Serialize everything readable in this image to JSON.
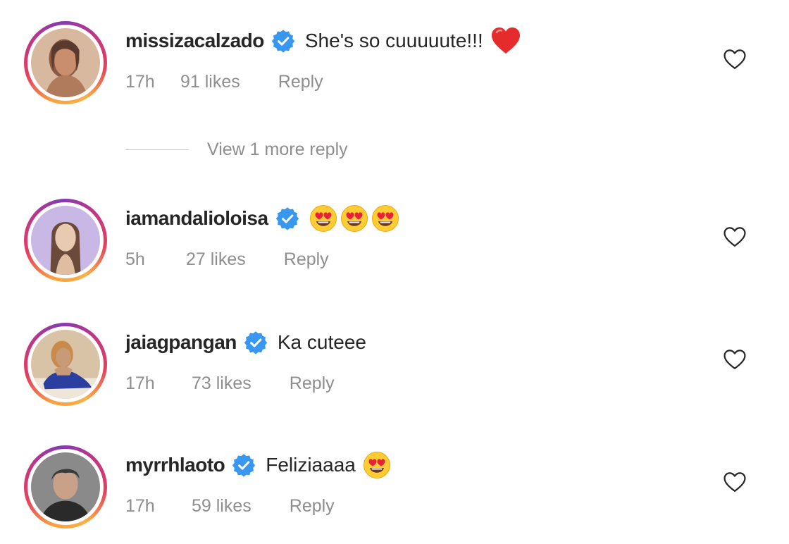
{
  "comments": [
    {
      "username": "missizacalzado",
      "text": "She's so cuuuuute!!!",
      "emoji": "red-heart",
      "time": "17h",
      "likes": "91 likes",
      "reply": "Reply",
      "avatar_colors": [
        "#8a5a44",
        "#5a3a2e",
        "#c88e6e"
      ]
    },
    {
      "username": "iamandalioloisa",
      "text": "",
      "emoji": "heart-eyes x3",
      "time": "5h",
      "likes": "27 likes",
      "reply": "Reply",
      "avatar_colors": [
        "#c9b7e6",
        "#6b4a3a",
        "#e8c9b1"
      ]
    },
    {
      "username": "jaiagpangan",
      "text": "Ka cuteee",
      "emoji": "",
      "time": "17h",
      "likes": "73 likes",
      "reply": "Reply",
      "avatar_colors": [
        "#d9c3a6",
        "#2a3fa0",
        "#c89a78"
      ]
    },
    {
      "username": "myrrhlaoto",
      "text": "Feliziaaaa",
      "emoji": "heart-eyes",
      "time": "17h",
      "likes": "59 likes",
      "reply": "Reply",
      "avatar_colors": [
        "#3a3a3a",
        "#2a2a2a",
        "#c9a088"
      ]
    }
  ],
  "view_replies": "View 1 more reply",
  "colors": {
    "text_primary": "#262626",
    "text_secondary": "#8e8e8e",
    "verified_blue": "#3897f0",
    "story_ring": [
      "#f9a03f",
      "#e4405f",
      "#c13584",
      "#833ab4"
    ]
  }
}
